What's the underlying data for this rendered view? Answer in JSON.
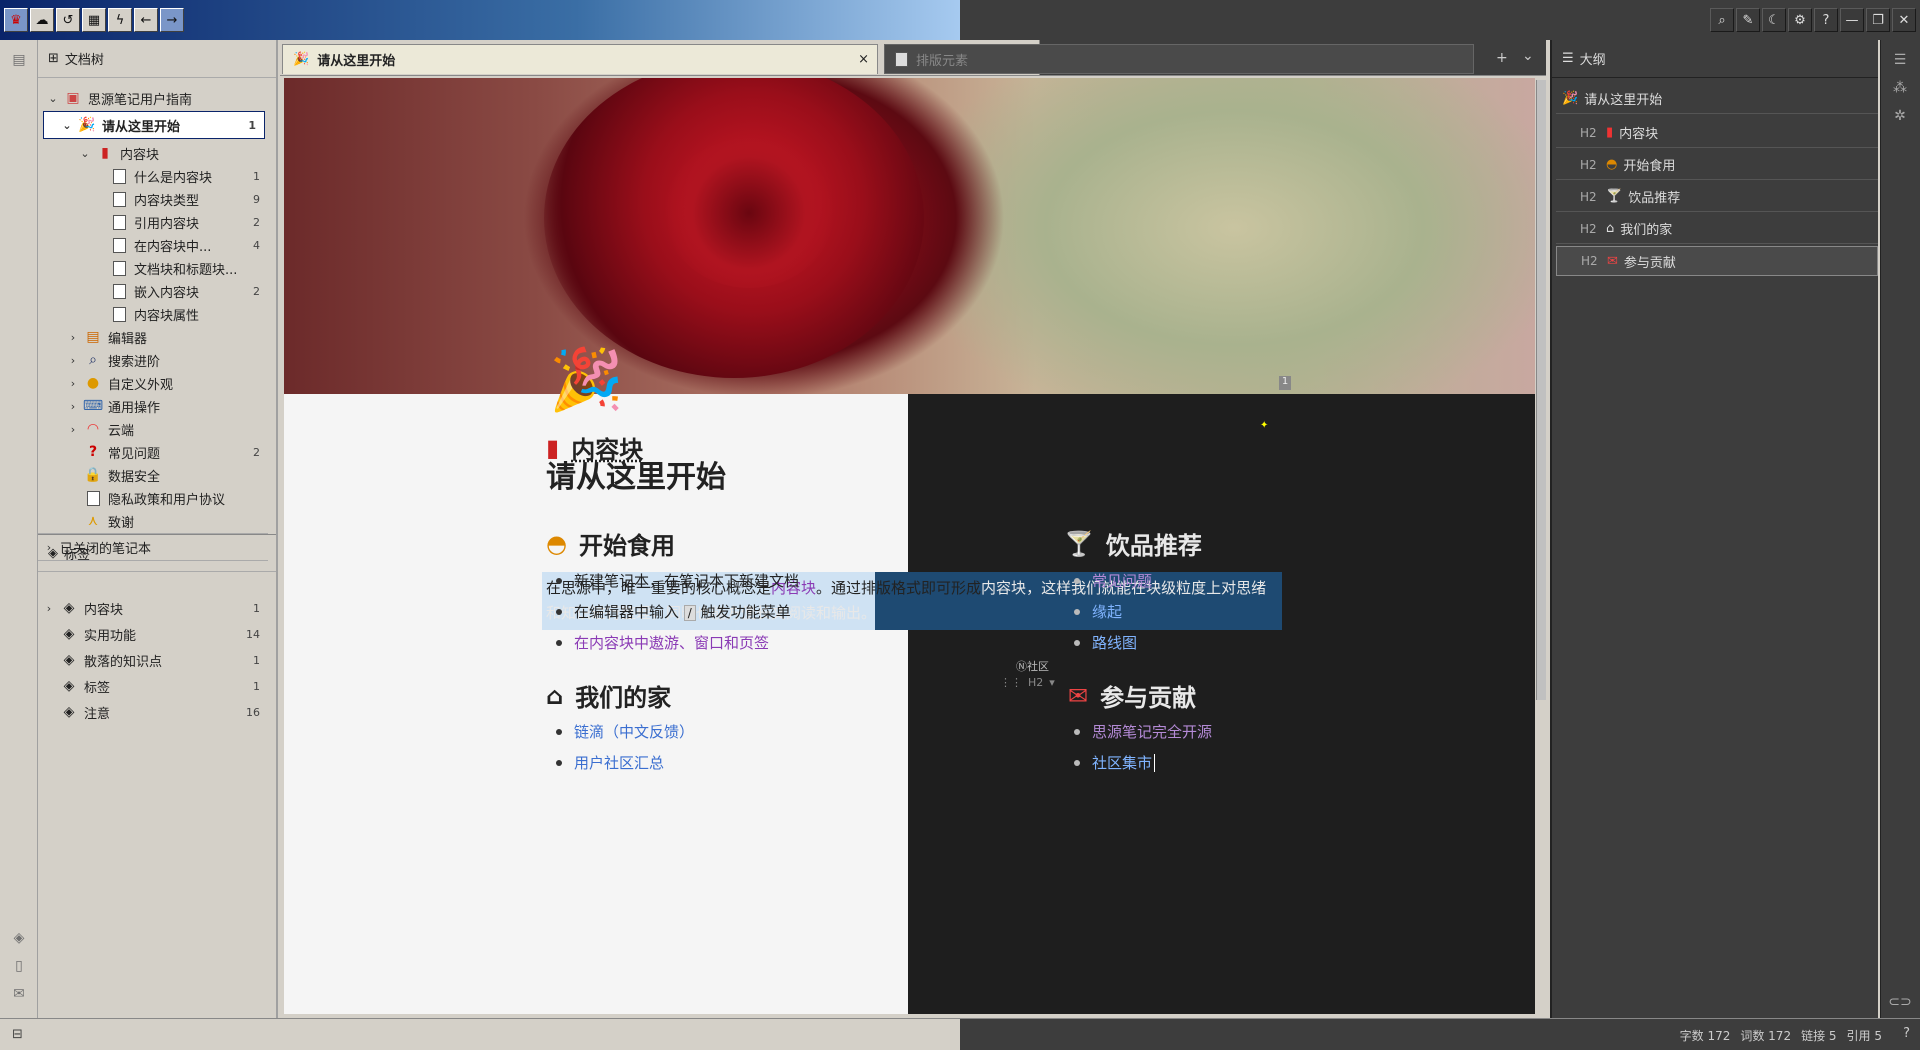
{
  "titlebar": {
    "left_icons": [
      "app-icon",
      "cloud-icon",
      "history-icon",
      "calendar-icon",
      "flash-icon",
      "back-icon",
      "forward-icon"
    ],
    "right_icons": [
      "search-icon",
      "edit-icon",
      "moon-icon",
      "gear-icon",
      "help-icon",
      "minimize-icon",
      "maximize-icon",
      "close-icon"
    ]
  },
  "tree": {
    "header": "文档树",
    "items": [
      {
        "label": "思源笔记用户指南",
        "count": ""
      },
      {
        "label": "请从这里开始",
        "count": "1"
      },
      {
        "label": "内容块",
        "count": ""
      },
      {
        "label": "什么是内容块",
        "count": "1"
      },
      {
        "label": "内容块类型",
        "count": "9"
      },
      {
        "label": "引用内容块",
        "count": "2"
      },
      {
        "label": "在内容块中...",
        "count": "4"
      },
      {
        "label": "文档块和标题块...",
        "count": ""
      },
      {
        "label": "嵌入内容块",
        "count": "2"
      },
      {
        "label": "内容块属性",
        "count": ""
      },
      {
        "label": "编辑器",
        "count": ""
      },
      {
        "label": "搜索进阶",
        "count": ""
      },
      {
        "label": "自定义外观",
        "count": ""
      },
      {
        "label": "通用操作",
        "count": ""
      },
      {
        "label": "云端",
        "count": ""
      },
      {
        "label": "常见问题",
        "count": "2"
      },
      {
        "label": "数据安全",
        "count": ""
      },
      {
        "label": "隐私政策和用户协议",
        "count": ""
      },
      {
        "label": "致谢",
        "count": ""
      }
    ],
    "closed_notebooks": "已关闭的笔记本"
  },
  "tags": {
    "header": "标签",
    "items": [
      {
        "label": "内容块",
        "count": "1"
      },
      {
        "label": "实用功能",
        "count": "14"
      },
      {
        "label": "散落的知识点",
        "count": "1"
      },
      {
        "label": "标签",
        "count": "1"
      },
      {
        "label": "注意",
        "count": "16"
      }
    ]
  },
  "tabs": [
    {
      "label": "请从这里开始",
      "active": true
    },
    {
      "label": "排版元素",
      "active": false
    }
  ],
  "doc": {
    "title": "请从这里开始",
    "badge": "1",
    "h_content": "内容块",
    "para_1": "在思源中，唯一重要的核心概念是",
    "para_link1": "内容块",
    "para_2": "。通过排版格式即可形成",
    "para_link2": "内容块",
    "para_3": "，这样我们就能在块级粒度上对思绪和知识进行整理，同时也能方便长文阅读和输出。",
    "h_start": "开始食用",
    "start_items": [
      "新建笔记本，在笔记本下新建文档",
      "在编辑器中输入",
      "触发功能菜单"
    ],
    "start_kbd": "/",
    "start_link": "在内容块中遨游、窗口和页签",
    "h_drink": "饮品推荐",
    "drink_items": [
      "常见问题",
      "缘起",
      "路线图"
    ],
    "h_home": "我们的家",
    "home_items": [
      "链滴（中文反馈）",
      "用户社区汇总"
    ],
    "h_contrib": "参与贡献",
    "contrib_items": [
      "思源笔记完全开源",
      "社区集市"
    ],
    "community_label": "社区",
    "h2_tag": "H2"
  },
  "outline": {
    "header": "大纲",
    "root": "请从这里开始",
    "items": [
      "内容块",
      "开始食用",
      "饮品推荐",
      "我们的家",
      "参与贡献"
    ],
    "h_tag": "H2"
  },
  "status": {
    "chars": "字数 172",
    "words": "词数 172",
    "links": "链接 5",
    "refs": "引用 5"
  },
  "colors": {
    "selection": "#0a246a",
    "link_purple": "#8a3ab5",
    "link_blue": "#3a6ed0"
  }
}
